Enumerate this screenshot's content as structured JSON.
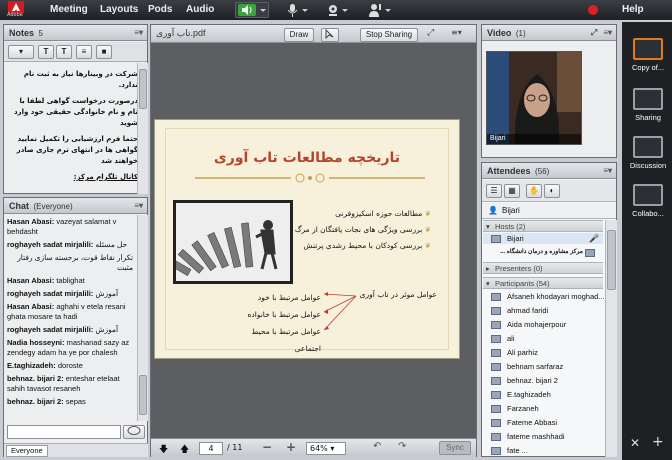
{
  "topbar": {
    "logo_text": "Adobe",
    "menus": [
      "Meeting",
      "Layouts",
      "Pods",
      "Audio"
    ],
    "help": "Help"
  },
  "notes": {
    "title": "Notes",
    "count": "5",
    "lines": [
      "شرکت در وبینارها نیاز به ثبت نام ندارد.",
      "درصورت درخواست گواهی لطفا با نام و نام خانوادگی حقیقی خود وارد شوید",
      "حتما فرم ارزشیابی را تکمیل نمایید گواهی ها در انتهای ترم جاری صادر خواهند شد",
      "کانال تلگرام مرکز:"
    ]
  },
  "chat": {
    "title": "Chat",
    "scope": "(Everyone)",
    "footer_tab": "Everyone",
    "messages": [
      {
        "name": "Hasan Abasi:",
        "text": "vazeyat salamat v behdasht"
      },
      {
        "name": "roghayeh sadat mirjalili:",
        "text": "حل مسئله"
      },
      {
        "name": "",
        "text": "تکرار نقاط قوت، برجسته سازی رفتار مثبت",
        "rtl": true
      },
      {
        "name": "Hasan Abasi:",
        "text": "tablighat"
      },
      {
        "name": "roghayeh sadat mirjalili:",
        "text": "آموزش"
      },
      {
        "name": "Hasan Abasi:",
        "text": "aghahi v etela resani ghata mosare ta hadi"
      },
      {
        "name": "roghayeh sadat mirjalili:",
        "text": "آموزش"
      },
      {
        "name": "Nadia hosseyni:",
        "text": "mashanad sazy az zendegy adam ha ye por chalesh"
      },
      {
        "name": "E.taghizadeh:",
        "text": "doroste"
      },
      {
        "name": "behnaz. bijari 2:",
        "text": "enteshar etelaat sahih tavasot resaneh"
      },
      {
        "name": "behnaz. bijari 2:",
        "text": "sepas"
      }
    ]
  },
  "share": {
    "filename": "تاب آوری.pdf",
    "draw_label": "Draw",
    "stop_label": "Stop Sharing",
    "page_current": "4",
    "page_total": "/ 11",
    "zoom": "64%",
    "sync_label": "Sync"
  },
  "slide": {
    "title": "تاریخچه مطالعات تاب آوری",
    "bullets": [
      "مطالعات حوزه اسکیزوفرنی",
      "بررسی ویژگی های نجات یافتگان از مرگ",
      "بررسی کودکان با محیط رشدی پرتنش"
    ],
    "factors_label": "عوامل موثر در تاب آوری",
    "factors": [
      "عوامل مرتبط با خود",
      "عوامل مرتبط با خانواده",
      "عوامل مرتبط با محیط اجتماعی"
    ]
  },
  "video": {
    "title": "Video",
    "count": "(1)",
    "caption": "Bijari"
  },
  "attendees": {
    "title": "Attendees",
    "count": "(56)",
    "me": "Bijari",
    "hosts_label": "Hosts (2)",
    "hosts": [
      "Bijari",
      "مرکز مشاوره و درمان دانشگاه ..."
    ],
    "presenters_label": "Presenters (0)",
    "participants_label": "Participants (54)",
    "participants": [
      "Afsaneh khodayari moghad...",
      "ahmad faridi",
      "Aida mohajerpour",
      "ali",
      "Ali parhiz",
      "behnam sarfaraz",
      "behnaz. bijari 2",
      "E.taghizadeh",
      "Farzaneh",
      "Fateme Abbasi",
      "fateme mashhadi",
      "fate ..."
    ]
  },
  "rail": {
    "items": [
      "Copy of...",
      "Sharing",
      "Discussion",
      "Collabo..."
    ]
  },
  "colors": {
    "accent": "#e07a1a",
    "slide_title": "#b5442a",
    "gold": "#c9a24a",
    "mic_green": "#3aa53a",
    "record_red": "#e02020"
  }
}
